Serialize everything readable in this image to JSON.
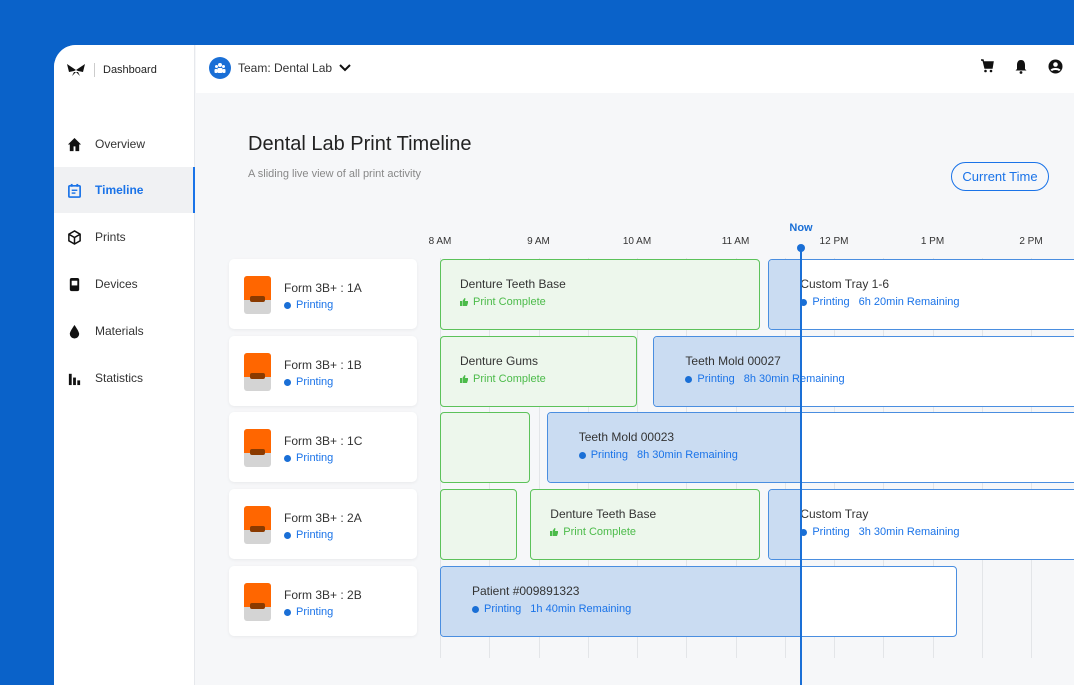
{
  "sidebar": {
    "brand": "Dashboard",
    "items": [
      {
        "label": "Overview",
        "icon": "home-icon"
      },
      {
        "label": "Timeline",
        "icon": "calendar-icon",
        "active": true
      },
      {
        "label": "Prints",
        "icon": "cube-icon"
      },
      {
        "label": "Devices",
        "icon": "printer-icon"
      },
      {
        "label": "Materials",
        "icon": "drop-icon"
      },
      {
        "label": "Statistics",
        "icon": "bar-chart-icon"
      }
    ]
  },
  "header": {
    "team": "Team: Dental Lab",
    "icons": [
      "cart-icon",
      "bell-icon",
      "account-icon"
    ]
  },
  "page": {
    "title": "Dental Lab Print Timeline",
    "subtitle": "A sliding live view of all print activity",
    "current_time_button": "Current Time"
  },
  "timeline": {
    "now_label": "Now",
    "now_time": "11:38 AM",
    "hours": [
      "8 AM",
      "9 AM",
      "10 AM",
      "11 AM",
      "12 PM",
      "1 PM",
      "2 PM"
    ],
    "colors": {
      "accent": "#1a73e8",
      "complete": "#4cbb4a",
      "printer": "#ff6600"
    },
    "devices": [
      {
        "name": "Form 3B+ : 1A",
        "status": "Printing",
        "jobs": [
          {
            "title": "Denture Teeth Base",
            "status": "Print Complete",
            "state": "complete",
            "start": "8:00",
            "end": "11:15"
          },
          {
            "title": "Custom Tray 1-6",
            "status": "Printing",
            "remaining": "6h 20min Remaining",
            "state": "printing",
            "start": "11:20"
          }
        ]
      },
      {
        "name": "Form 3B+ : 1B",
        "status": "Printing",
        "jobs": [
          {
            "title": "Denture Gums",
            "status": "Print Complete",
            "state": "complete",
            "start": "8:00",
            "end": "10:00"
          },
          {
            "title": "Teeth Mold 00027",
            "status": "Printing",
            "remaining": "8h 30min Remaining",
            "state": "printing",
            "start": "10:10"
          }
        ]
      },
      {
        "name": "Form 3B+ : 1C",
        "status": "Printing",
        "jobs": [
          {
            "title": "",
            "status": "",
            "state": "complete",
            "start": "8:00",
            "end": "8:55"
          },
          {
            "title": "Teeth Mold 00023",
            "status": "Printing",
            "remaining": "8h 30min Remaining",
            "state": "printing",
            "start": "9:05"
          }
        ]
      },
      {
        "name": "Form 3B+ : 2A",
        "status": "Printing",
        "jobs": [
          {
            "title": "",
            "status": "",
            "state": "complete",
            "start": "8:00",
            "end": "8:47"
          },
          {
            "title": "Denture Teeth Base",
            "status": "Print Complete",
            "state": "complete",
            "start": "8:55",
            "end": "11:15"
          },
          {
            "title": "Custom Tray",
            "status": "Printing",
            "remaining": "3h 30min Remaining",
            "state": "printing",
            "start": "11:20"
          }
        ]
      },
      {
        "name": "Form 3B+ : 2B",
        "status": "Printing",
        "jobs": [
          {
            "title": "Patient #009891323",
            "status": "Printing",
            "remaining": "1h 40min Remaining",
            "state": "printing",
            "start": "8:00",
            "end": "13:15"
          }
        ]
      }
    ]
  }
}
